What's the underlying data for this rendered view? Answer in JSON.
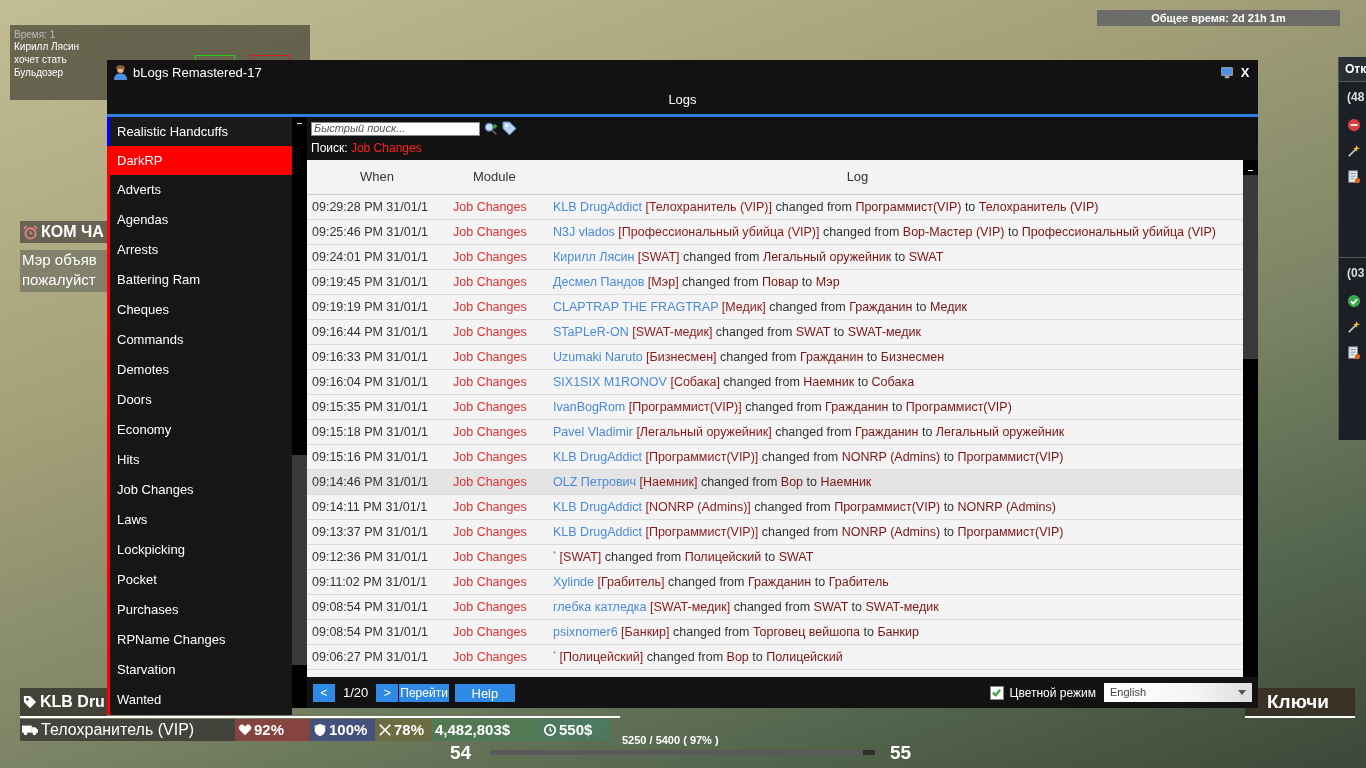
{
  "hud": {
    "vote": {
      "time": "Время: 1",
      "lines": [
        "Кирилл Лясин",
        "хочет стать",
        "Бульдозер"
      ]
    },
    "total_time": "Общее время: 2d 21h 1m",
    "lockdown": {
      "title": "КОМ ЧА",
      "lines": [
        "Мэр объяв",
        "пожалуйст"
      ]
    },
    "player_tag": "KLB Dru",
    "job": "Телохранитель (VIP)",
    "stats": [
      {
        "kind": "health",
        "value": "92%"
      },
      {
        "kind": "armor",
        "value": "100%"
      },
      {
        "kind": "hunger",
        "value": "78%"
      },
      {
        "kind": "money",
        "value": "4,482,803$"
      },
      {
        "kind": "salary",
        "value": "550$"
      }
    ],
    "xp": {
      "current_level": "54",
      "reading": "5250 / 5400 ( 97% )",
      "level": 0.97,
      "next_level": "55"
    },
    "keys": "Ключи",
    "side_panel": {
      "title": "Отк",
      "groups": [
        {
          "label": "(48",
          "approved": false
        },
        {
          "label": "(03",
          "approved": true
        }
      ]
    }
  },
  "window": {
    "title": "bLogs Remastered-17",
    "close": "X",
    "heading": "Logs"
  },
  "sidebar": [
    {
      "kind": "category",
      "label": "Realistic Handcuffs",
      "color": "#0000ff",
      "expanded": false
    },
    {
      "kind": "category",
      "label": "DarkRP",
      "color": "#ff0000",
      "expanded": true,
      "children": [
        {
          "label": "Adverts"
        },
        {
          "label": "Agendas"
        },
        {
          "label": "Arrests"
        },
        {
          "label": "Battering Ram"
        },
        {
          "label": "Cheques"
        },
        {
          "label": "Commands"
        },
        {
          "label": "Demotes"
        },
        {
          "label": "Doors"
        },
        {
          "label": "Economy"
        },
        {
          "label": "Hits"
        },
        {
          "label": "Job Changes"
        },
        {
          "label": "Laws"
        },
        {
          "label": "Lockpicking"
        },
        {
          "label": "Pocket"
        },
        {
          "label": "Purchases"
        },
        {
          "label": "RPName Changes"
        },
        {
          "label": "Starvation"
        },
        {
          "label": "Wanted"
        }
      ]
    }
  ],
  "search": {
    "placeholder": "Быстрый поиск...",
    "label": "Поиск:",
    "term": "Job Changes"
  },
  "table": {
    "columns": [
      "When",
      "Module",
      "Log"
    ],
    "rows": [
      {
        "time": "09:29:28 PM 31/01/1",
        "module": "Job Changes",
        "log": [
          {
            "kind": "player",
            "text": "KLB DrugAddict"
          },
          {
            "kind": "job",
            "text": "[Телохранитель (VIP)]"
          },
          {
            "kind": "plain",
            "text": "changed from"
          },
          {
            "kind": "role",
            "text": "Программист(VIP)"
          },
          {
            "kind": "plain",
            "text": "to"
          },
          {
            "kind": "role",
            "text": "Телохранитель (VIP)"
          }
        ],
        "selected": false
      },
      {
        "time": "09:25:46 PM 31/01/1",
        "module": "Job Changes",
        "log": [
          {
            "kind": "player",
            "text": "N3J vlados"
          },
          {
            "kind": "job",
            "text": "[Профессиональный убийца (VIP)]"
          },
          {
            "kind": "plain",
            "text": "changed from"
          },
          {
            "kind": "role",
            "text": "Вор-Мастер (VIP)"
          },
          {
            "kind": "plain",
            "text": "to"
          },
          {
            "kind": "role",
            "text": "Профессиональный убийца (VIP)"
          }
        ],
        "selected": false
      },
      {
        "time": "09:24:01 PM 31/01/1",
        "module": "Job Changes",
        "log": [
          {
            "kind": "player",
            "text": "Кирилл Лясин"
          },
          {
            "kind": "job",
            "text": "[SWAT]"
          },
          {
            "kind": "plain",
            "text": "changed from"
          },
          {
            "kind": "role",
            "text": "Легальный оружейник"
          },
          {
            "kind": "plain",
            "text": "to"
          },
          {
            "kind": "role",
            "text": "SWAT"
          }
        ],
        "selected": false
      },
      {
        "time": "09:19:45 PM 31/01/1",
        "module": "Job Changes",
        "log": [
          {
            "kind": "player",
            "text": "Десмел Пандов"
          },
          {
            "kind": "job",
            "text": "[Мэр]"
          },
          {
            "kind": "plain",
            "text": "changed from"
          },
          {
            "kind": "role",
            "text": "Повар"
          },
          {
            "kind": "plain",
            "text": "to"
          },
          {
            "kind": "role",
            "text": "Мэр"
          }
        ],
        "selected": false
      },
      {
        "time": "09:19:19 PM 31/01/1",
        "module": "Job Changes",
        "log": [
          {
            "kind": "player",
            "text": "CLAPTRAP THE FRAGTRAP"
          },
          {
            "kind": "job",
            "text": "[Медик]"
          },
          {
            "kind": "plain",
            "text": "changed from"
          },
          {
            "kind": "role",
            "text": "Гражданин"
          },
          {
            "kind": "plain",
            "text": "to"
          },
          {
            "kind": "role",
            "text": "Медик"
          }
        ],
        "selected": false
      },
      {
        "time": "09:16:44 PM 31/01/1",
        "module": "Job Changes",
        "log": [
          {
            "kind": "player",
            "text": "STaPLeR-ON"
          },
          {
            "kind": "job",
            "text": "[SWAT-медик]"
          },
          {
            "kind": "plain",
            "text": "changed from"
          },
          {
            "kind": "role",
            "text": "SWAT"
          },
          {
            "kind": "plain",
            "text": "to"
          },
          {
            "kind": "role",
            "text": "SWAT-медик"
          }
        ],
        "selected": false
      },
      {
        "time": "09:16:33 PM 31/01/1",
        "module": "Job Changes",
        "log": [
          {
            "kind": "player",
            "text": "Uzumaki Naruto"
          },
          {
            "kind": "job",
            "text": "[Бизнесмен]"
          },
          {
            "kind": "plain",
            "text": "changed from"
          },
          {
            "kind": "role",
            "text": "Гражданин"
          },
          {
            "kind": "plain",
            "text": "to"
          },
          {
            "kind": "role",
            "text": "Бизнесмен"
          }
        ],
        "selected": false
      },
      {
        "time": "09:16:04 PM 31/01/1",
        "module": "Job Changes",
        "log": [
          {
            "kind": "player",
            "text": "SIX1SIX M1RONOV"
          },
          {
            "kind": "job",
            "text": "[Собака]"
          },
          {
            "kind": "plain",
            "text": "changed from"
          },
          {
            "kind": "role",
            "text": "Наемник"
          },
          {
            "kind": "plain",
            "text": "to"
          },
          {
            "kind": "role",
            "text": "Собака"
          }
        ],
        "selected": false
      },
      {
        "time": "09:15:35 PM 31/01/1",
        "module": "Job Changes",
        "log": [
          {
            "kind": "player",
            "text": "IvanBogRom"
          },
          {
            "kind": "job",
            "text": "[Программист(VIP)]"
          },
          {
            "kind": "plain",
            "text": "changed from"
          },
          {
            "kind": "role",
            "text": "Гражданин"
          },
          {
            "kind": "plain",
            "text": "to"
          },
          {
            "kind": "role",
            "text": "Программист(VIP)"
          }
        ],
        "selected": false
      },
      {
        "time": "09:15:18 PM 31/01/1",
        "module": "Job Changes",
        "log": [
          {
            "kind": "player",
            "text": "Pavel Vladimir"
          },
          {
            "kind": "job",
            "text": "[Легальный оружейник]"
          },
          {
            "kind": "plain",
            "text": "changed from"
          },
          {
            "kind": "role",
            "text": "Гражданин"
          },
          {
            "kind": "plain",
            "text": "to"
          },
          {
            "kind": "role",
            "text": "Легальный оружейник"
          }
        ],
        "selected": false
      },
      {
        "time": "09:15:16 PM 31/01/1",
        "module": "Job Changes",
        "log": [
          {
            "kind": "player",
            "text": "KLB DrugAddict"
          },
          {
            "kind": "job",
            "text": "[Программист(VIP)]"
          },
          {
            "kind": "plain",
            "text": "changed from"
          },
          {
            "kind": "role",
            "text": "NONRP (Admins)"
          },
          {
            "kind": "plain",
            "text": "to"
          },
          {
            "kind": "role",
            "text": "Программист(VIP)"
          }
        ],
        "selected": false
      },
      {
        "time": "09:14:46 PM 31/01/1",
        "module": "Job Changes",
        "log": [
          {
            "kind": "player",
            "text": "OLZ Петрович"
          },
          {
            "kind": "job",
            "text": "[Наемник]"
          },
          {
            "kind": "plain",
            "text": "changed from"
          },
          {
            "kind": "role",
            "text": "Вор"
          },
          {
            "kind": "plain",
            "text": "to"
          },
          {
            "kind": "role",
            "text": "Наемник"
          }
        ],
        "selected": true
      },
      {
        "time": "09:14:11 PM 31/01/1",
        "module": "Job Changes",
        "log": [
          {
            "kind": "player",
            "text": "KLB DrugAddict"
          },
          {
            "kind": "job",
            "text": "[NONRP (Admins)]"
          },
          {
            "kind": "plain",
            "text": "changed from"
          },
          {
            "kind": "role",
            "text": "Программист(VIP)"
          },
          {
            "kind": "plain",
            "text": "to"
          },
          {
            "kind": "role",
            "text": "NONRP (Admins)"
          }
        ],
        "selected": false
      },
      {
        "time": "09:13:37 PM 31/01/1",
        "module": "Job Changes",
        "log": [
          {
            "kind": "player",
            "text": "KLB DrugAddict"
          },
          {
            "kind": "job",
            "text": "[Программист(VIP)]"
          },
          {
            "kind": "plain",
            "text": "changed from"
          },
          {
            "kind": "role",
            "text": "NONRP (Admins)"
          },
          {
            "kind": "plain",
            "text": "to"
          },
          {
            "kind": "role",
            "text": "Программист(VIP)"
          }
        ],
        "selected": false
      },
      {
        "time": "09:12:36 PM 31/01/1",
        "module": "Job Changes",
        "log": [
          {
            "kind": "mark",
            "text": "*"
          },
          {
            "kind": "job",
            "text": "[SWAT]"
          },
          {
            "kind": "plain",
            "text": "changed from"
          },
          {
            "kind": "role",
            "text": "Полицейский"
          },
          {
            "kind": "plain",
            "text": "to"
          },
          {
            "kind": "role",
            "text": "SWAT"
          }
        ],
        "selected": false
      },
      {
        "time": "09:11:02 PM 31/01/1",
        "module": "Job Changes",
        "log": [
          {
            "kind": "player",
            "text": "Xylinde"
          },
          {
            "kind": "job",
            "text": "[Грабитель]"
          },
          {
            "kind": "plain",
            "text": "changed from"
          },
          {
            "kind": "role",
            "text": "Гражданин"
          },
          {
            "kind": "plain",
            "text": "to"
          },
          {
            "kind": "role",
            "text": "Грабитель"
          }
        ],
        "selected": false
      },
      {
        "time": "09:08:54 PM 31/01/1",
        "module": "Job Changes",
        "log": [
          {
            "kind": "player",
            "text": "глебка катледка"
          },
          {
            "kind": "job",
            "text": "[SWAT-медик]"
          },
          {
            "kind": "plain",
            "text": "changed from"
          },
          {
            "kind": "role",
            "text": "SWAT"
          },
          {
            "kind": "plain",
            "text": "to"
          },
          {
            "kind": "role",
            "text": "SWAT-медик"
          }
        ],
        "selected": false
      },
      {
        "time": "09:08:54 PM 31/01/1",
        "module": "Job Changes",
        "log": [
          {
            "kind": "player",
            "text": "psixnomer6"
          },
          {
            "kind": "job",
            "text": "[Банкир]"
          },
          {
            "kind": "plain",
            "text": "changed from"
          },
          {
            "kind": "role",
            "text": "Торговец вейшопа"
          },
          {
            "kind": "plain",
            "text": "to"
          },
          {
            "kind": "role",
            "text": "Банкир"
          }
        ],
        "selected": false
      },
      {
        "time": "09:06:27 PM 31/01/1",
        "module": "Job Changes",
        "log": [
          {
            "kind": "mark",
            "text": "*"
          },
          {
            "kind": "job",
            "text": "[Полицейский]"
          },
          {
            "kind": "plain",
            "text": "changed from"
          },
          {
            "kind": "role",
            "text": "Вор"
          },
          {
            "kind": "plain",
            "text": "to"
          },
          {
            "kind": "role",
            "text": "Полицейский"
          }
        ],
        "selected": false
      }
    ]
  },
  "pagination": {
    "prev": "<",
    "page": "1/20",
    "next": ">",
    "go": "Перейти",
    "help": "Help"
  },
  "color_mode": {
    "label": "Цветной режим",
    "checked": true
  },
  "language": {
    "value": "English"
  }
}
